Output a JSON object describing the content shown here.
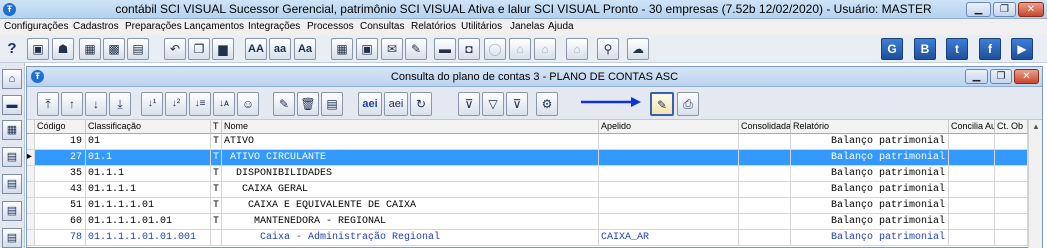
{
  "window": {
    "title": "contábil SCI VISUAL Sucessor Gerencial, patrimônio SCI VISUAL Ativa e lalur SCI VISUAL Pronto - 30 empresas  (7.52b 12/02/2020) - Usuário: MASTER",
    "app_icon_glyph": "Ŧ",
    "minimize_glyph": "▁",
    "maximize_glyph": "❐",
    "close_glyph": "✕"
  },
  "menu": {
    "items": [
      "Configurações",
      "Cadastros",
      "Preparações",
      "Lançamentos",
      "Integrações",
      "Processos",
      "Consultas",
      "Relatórios",
      "Utilitários",
      "Janelas",
      "Ajuda"
    ]
  },
  "toolbar": {
    "buttons": [
      {
        "icon": "help-icon",
        "glyph": "?"
      },
      {
        "icon": "document-icon",
        "glyph": "▣"
      },
      {
        "icon": "users-icon",
        "glyph": "☗"
      },
      {
        "icon": "calculator-icon",
        "glyph": "▦"
      },
      {
        "icon": "calendar-grid-icon",
        "glyph": "▩"
      },
      {
        "icon": "chart-icon",
        "glyph": "▤"
      },
      {
        "icon": "undo-icon",
        "glyph": "↶"
      },
      {
        "icon": "copy-icon",
        "glyph": "❐"
      },
      {
        "icon": "paste-icon",
        "glyph": "▆"
      },
      {
        "icon": "font-large-label",
        "glyph": "AA"
      },
      {
        "icon": "font-lower-label",
        "glyph": "aa"
      },
      {
        "icon": "font-mixed-label",
        "glyph": "Aa"
      },
      {
        "icon": "table-icon",
        "glyph": "▦"
      },
      {
        "icon": "screen-icon",
        "glyph": "▣"
      },
      {
        "icon": "mail-icon",
        "glyph": "✉"
      },
      {
        "icon": "mail-tools-icon",
        "glyph": "✎"
      },
      {
        "icon": "folder-icon",
        "glyph": "▬"
      },
      {
        "icon": "window-icon",
        "glyph": "◘"
      },
      {
        "icon": "circle-icon",
        "glyph": "◯"
      },
      {
        "icon": "home-disabled-icon",
        "glyph": "⌂"
      },
      {
        "icon": "home-icon",
        "glyph": "⌂"
      },
      {
        "icon": "search-icon",
        "glyph": "⚲"
      },
      {
        "icon": "cloud-icon",
        "glyph": "☁"
      },
      {
        "icon": "g-logo-icon",
        "glyph": "G"
      },
      {
        "icon": "b-logo-icon",
        "glyph": "B"
      },
      {
        "icon": "twitter-icon",
        "glyph": "t"
      },
      {
        "icon": "facebook-icon",
        "glyph": "f"
      },
      {
        "icon": "youtube-icon",
        "glyph": "▶"
      }
    ]
  },
  "left_bar": {
    "buttons": [
      {
        "icon": "home-icon",
        "glyph": "⌂"
      },
      {
        "icon": "folder-icon",
        "glyph": "▬"
      },
      {
        "icon": "calculator-icon",
        "glyph": "▦"
      },
      {
        "icon": "report-icon",
        "glyph": "▤"
      },
      {
        "icon": "report-edit-icon",
        "glyph": "▤"
      },
      {
        "icon": "report-list-icon",
        "glyph": "▤"
      },
      {
        "icon": "report-export-icon",
        "glyph": "▤"
      }
    ]
  },
  "child_window": {
    "title": "Consulta do plano de contas 3 - PLANO DE CONTAS ASC",
    "toolbar": [
      {
        "icon": "move-top-icon",
        "glyph": "⤒"
      },
      {
        "icon": "move-up-icon",
        "glyph": "↑"
      },
      {
        "icon": "move-down-icon",
        "glyph": "↓"
      },
      {
        "icon": "move-bottom-icon",
        "glyph": "⤓"
      },
      {
        "icon": "sort-asc-icon",
        "glyph": "↓¹"
      },
      {
        "icon": "sort-desc-icon",
        "glyph": "↓²"
      },
      {
        "icon": "sort-list-icon",
        "glyph": "↓≡"
      },
      {
        "icon": "sort-az-icon",
        "glyph": "↓ᴀ"
      },
      {
        "icon": "smiley-icon",
        "glyph": "☺"
      },
      {
        "icon": "edit-icon",
        "glyph": "✎"
      },
      {
        "icon": "delete-icon",
        "glyph": "🗑"
      },
      {
        "icon": "document-icon",
        "glyph": "▤"
      },
      {
        "icon": "aei-bold-label",
        "glyph": "aei"
      },
      {
        "icon": "aei-label",
        "glyph": "aei"
      },
      {
        "icon": "refresh-icon",
        "glyph": "↻"
      },
      {
        "icon": "filter-edit-icon",
        "glyph": "⊽"
      },
      {
        "icon": "filter-icon",
        "glyph": "▽"
      },
      {
        "icon": "filter-clear-icon",
        "glyph": "⊽"
      },
      {
        "icon": "settings-icon",
        "glyph": "⚙"
      },
      {
        "icon": "edit-form-icon",
        "glyph": "✎"
      },
      {
        "icon": "print-icon",
        "glyph": "⎙"
      }
    ],
    "arrow_color": "#1030d8"
  },
  "grid": {
    "columns": [
      "Código",
      "Classificação",
      "T",
      "Nome",
      "Apelido",
      "Consolidada",
      "Relatório",
      "Concilia Aut.",
      "Ct. Ob"
    ],
    "rows": [
      {
        "codigo": "19",
        "classificacao": "01",
        "t": "T",
        "nome": "ATIVO",
        "apelido": "",
        "relatorio": "Balanço patrimonial",
        "selected": false,
        "blue": false
      },
      {
        "codigo": "27",
        "classificacao": "01.1",
        "t": "T",
        "nome": " ATIVO CIRCULANTE",
        "apelido": "",
        "relatorio": "Balanço patrimonial",
        "selected": true,
        "blue": false
      },
      {
        "codigo": "35",
        "classificacao": "01.1.1",
        "t": "T",
        "nome": "  DISPONIBILIDADES",
        "apelido": "",
        "relatorio": "Balanço patrimonial",
        "selected": false,
        "blue": false
      },
      {
        "codigo": "43",
        "classificacao": "01.1.1.1",
        "t": "T",
        "nome": "   CAIXA GERAL",
        "apelido": "",
        "relatorio": "Balanço patrimonial",
        "selected": false,
        "blue": false
      },
      {
        "codigo": "51",
        "classificacao": "01.1.1.1.01",
        "t": "T",
        "nome": "    CAIXA E EQUIVALENTE DE CAIXA",
        "apelido": "",
        "relatorio": "Balanço patrimonial",
        "selected": false,
        "blue": false
      },
      {
        "codigo": "60",
        "classificacao": "01.1.1.1.01.01",
        "t": "T",
        "nome": "     MANTENEDORA - REGIONAL",
        "apelido": "",
        "relatorio": "Balanço patrimonial",
        "selected": false,
        "blue": false
      },
      {
        "codigo": "78",
        "classificacao": "01.1.1.1.01.01.001",
        "t": "",
        "nome": "      Caixa - Administração Regional",
        "apelido": "CAIXA_AR",
        "relatorio": "Balanço patrimonial",
        "selected": false,
        "blue": true
      }
    ],
    "selected_row_marker": "▸",
    "scroll_up_glyph": "▲"
  }
}
